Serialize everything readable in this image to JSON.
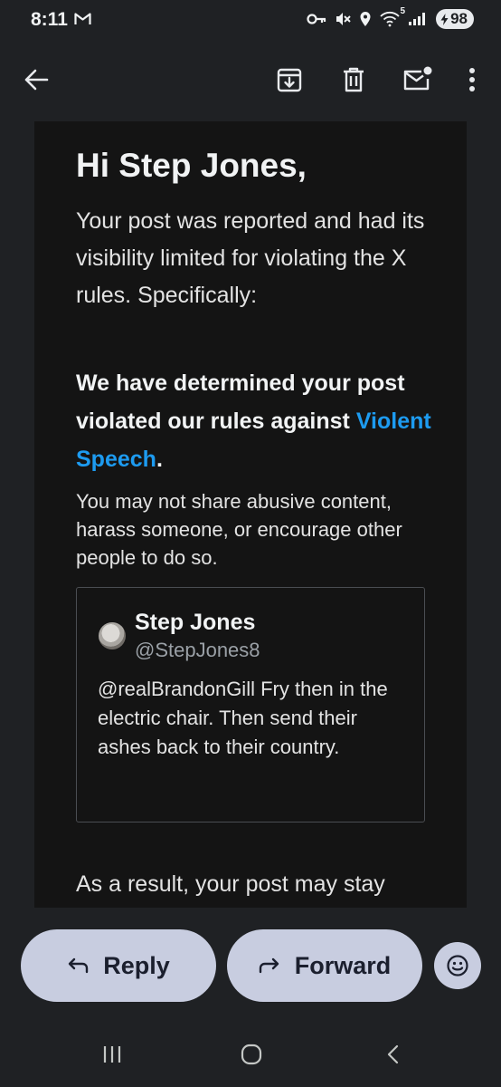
{
  "status_bar": {
    "time": "8:11",
    "battery": "98",
    "wifi_label": "5",
    "icons": [
      "gmail-icon",
      "key-icon",
      "mute-icon",
      "location-icon",
      "wifi-icon",
      "signal-icon",
      "battery-icon"
    ]
  },
  "app_bar": {
    "icons": [
      "back-arrow-icon",
      "archive-icon",
      "delete-icon",
      "mark-unread-icon",
      "more-vert-icon"
    ]
  },
  "email": {
    "greeting": "Hi Step Jones,",
    "intro": "Your post was reported and had its visibility limited for violating the X rules. Specifically:",
    "determination_prefix": "We have determined your post violated our rules against ",
    "rule_link": "Violent Speech",
    "determination_suffix": ".",
    "explanation": "You may not share abusive content, harass someone, or encourage other people to do so.",
    "post": {
      "author_name": "Step Jones",
      "author_handle": "@StepJones8",
      "text": "@realBrandonGill Fry then in the electric chair. Then send their ashes back to their country."
    },
    "result_text": "As a result, your post may stay"
  },
  "actions": {
    "reply_label": "Reply",
    "forward_label": "Forward"
  },
  "colors": {
    "background": "#1f2124",
    "email_background": "#141414",
    "link": "#1d9bf0",
    "pill": "#c8cde0"
  }
}
